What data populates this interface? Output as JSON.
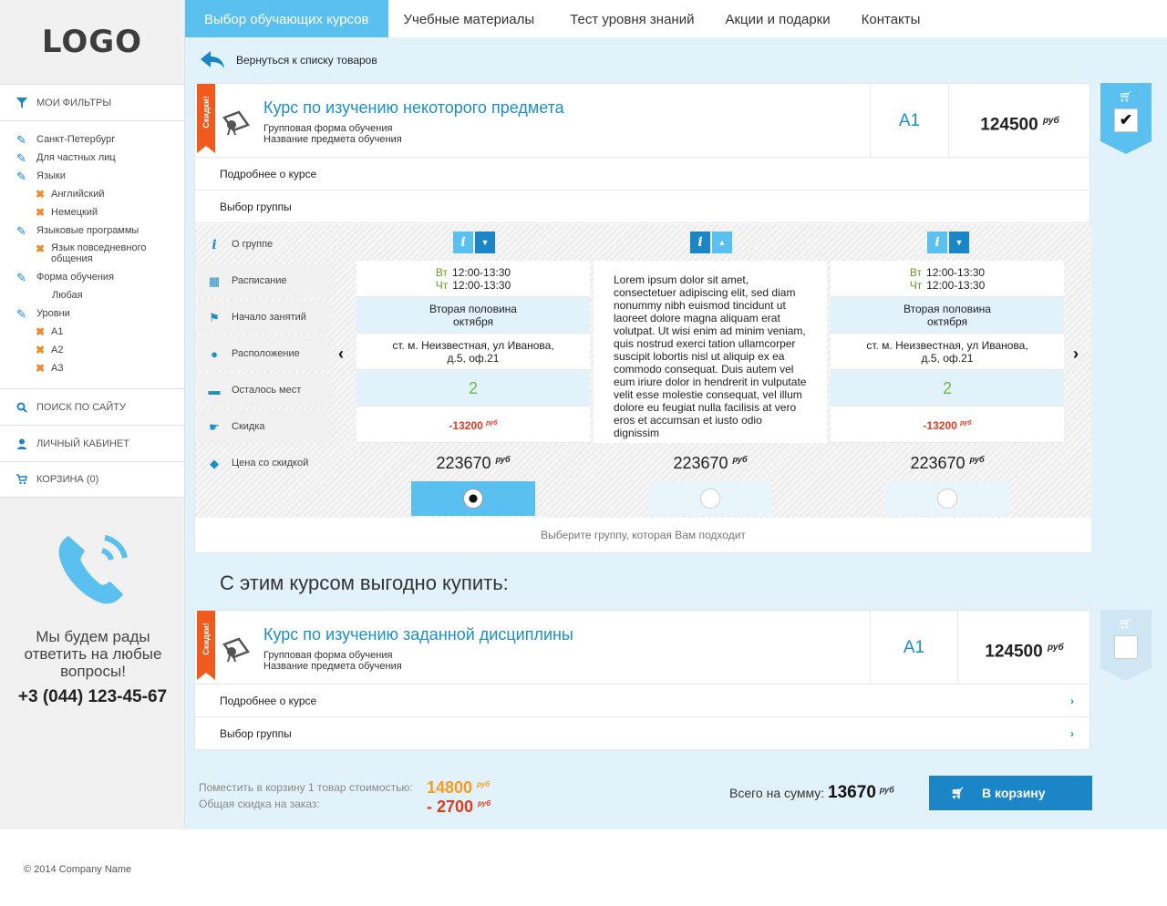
{
  "logo": "LOGO",
  "nav": {
    "items": [
      "Выбор обучающих курсов",
      "Учебные материалы",
      "Тест уровня знаний",
      "Акции и подарки",
      "Контакты"
    ]
  },
  "sidebar": {
    "filters_title": "Мои фильтры",
    "filters": {
      "city": "Санкт-Петербург",
      "audience": "Для частных лиц",
      "languages": "Языки",
      "lang_en": "Английский",
      "lang_de": "Немецкий",
      "programs": "Языковые программы",
      "program_daily": "Язык повседневного общения",
      "form": "Форма обучения",
      "form_any": "Любая",
      "levels": "Уровни",
      "level_a1": "A1",
      "level_a2": "A2",
      "level_a3": "A3"
    },
    "search": "Поиск по сайту",
    "account": "Личный кабинет",
    "cart": "Корзина (0)",
    "contact_msg": "Мы будем рады ответить на любые вопросы!",
    "contact_phone": "+3 (044) 123-45-67"
  },
  "back_link": "Вернуться к списку товаров",
  "ribbon": "Скидки!",
  "course1": {
    "title": "Курс по изучению некоторого предмета",
    "line1": "Групповая форма обучения",
    "line2": "Название предмета обучения",
    "level": "A1",
    "price": "124500",
    "currency": "руб",
    "more": "Подробнее о курсе",
    "group": "Выбор группы"
  },
  "groups": {
    "labels": {
      "about": "О группе",
      "schedule": "Расписание",
      "start": "Начало занятий",
      "location": "Расположение",
      "seats": "Осталось мест",
      "discount": "Скидка",
      "price": "Цена со скидкой"
    },
    "g1": {
      "day1": "Вт",
      "time1": "12:00-13:30",
      "day2": "Чт",
      "time2": "12:00-13:30",
      "start": "Вторая половина октября",
      "location": "ст. м. Неизвестная, ул Иванова, д.5, оф.21",
      "seats": "2",
      "discount": "-13200",
      "price": "223670"
    },
    "g2": {
      "lorem": "Lorem ipsum dolor sit amet, consectetuer adipiscing elit, sed diam nonummy nibh euismod tincidunt ut laoreet dolore magna aliquam erat volutpat. Ut wisi enim ad minim veniam, quis nostrud exerci tation ullamcorper suscipit lobortis nisl ut aliquip ex ea commodo consequat. Duis autem vel eum iriure dolor in hendrerit in vulputate velit esse molestie consequat, vel illum dolore eu feugiat nulla facilisis at vero eros et accumsan et iusto odio dignissim",
      "price": "223670"
    },
    "g3": {
      "day1": "Вт",
      "time1": "12:00-13:30",
      "day2": "Чт",
      "time2": "12:00-13:30",
      "start": "Вторая половина октября",
      "location": "ст. м. Неизвестная, ул Иванова, д.5, оф.21",
      "seats": "2",
      "discount": "-13200",
      "price": "223670"
    },
    "hint": "Выберите группу, которая Вам подходит"
  },
  "section_title": "С этим курсом выгодно купить:",
  "course2": {
    "title": "Курс по изучению заданной дисциплины",
    "line1": "Групповая форма обучения",
    "line2": "Название предмета обучения",
    "level": "A1",
    "price": "124500",
    "currency": "руб",
    "more": "Подробнее о курсе",
    "group": "Выбор группы"
  },
  "summary": {
    "line1": "Поместить в корзину 1 товар стоимостью:",
    "line2": "Общая скидка на заказ:",
    "val1": "14800",
    "val2": "- 2700",
    "total_label": "Всего на сумму:",
    "total": "13670",
    "button": "В корзину"
  },
  "footer": "© 2014 Company Name",
  "colors": {
    "accent": "#5ac0ef",
    "dark_accent": "#1a86c8",
    "ribbon": "#f05a1c",
    "bg": "#e2f2fb"
  }
}
